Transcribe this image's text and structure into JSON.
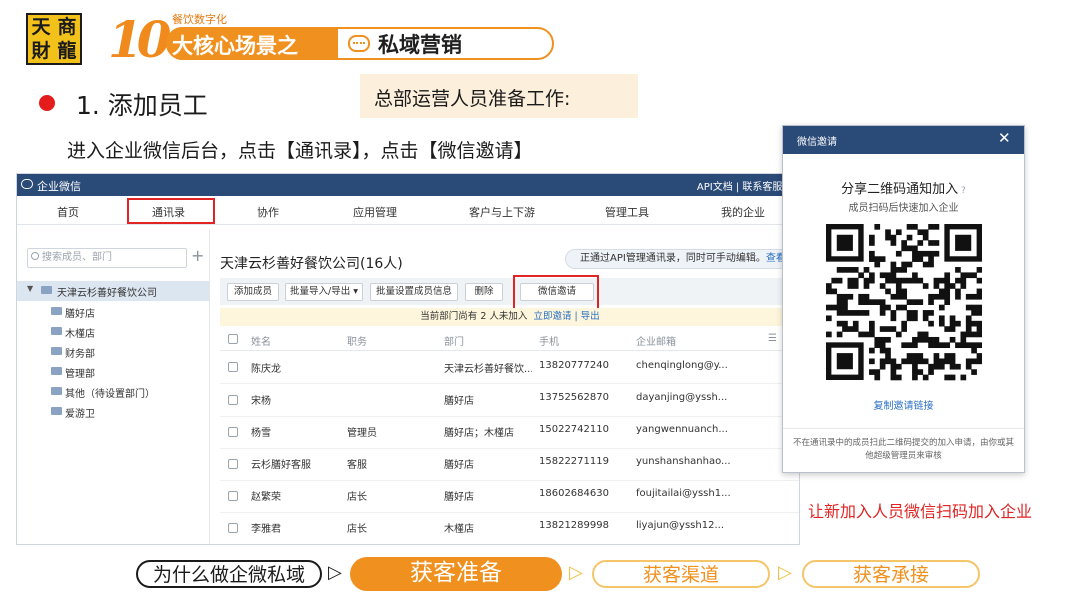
{
  "logo": {
    "chars": [
      "天",
      "商",
      "財",
      "龍"
    ]
  },
  "header": {
    "big_number": "10",
    "small_tag": "餐饮数字化",
    "banner_left": "大核心场景之",
    "banner_right": "私域营销",
    "chat_icon": "chat-bubble-icon"
  },
  "section": {
    "title": "1. 添加员工",
    "prep_label": "总部运营人员准备工作:",
    "instruction": "进入企业微信后台，点击【通讯录】，点击【微信邀请】"
  },
  "wework": {
    "app_name": "企业微信",
    "top_links": "API文档  |  联系客服  |",
    "nav": [
      "首页",
      "通讯录",
      "协作",
      "应用管理",
      "客户与上下游",
      "管理工具",
      "我的企业"
    ],
    "search_placeholder": "搜索成员、部门",
    "tree_root": "天津云杉善好餐饮公司",
    "tree_children": [
      "膳好店",
      "木槿店",
      "财务部",
      "管理部",
      "其他（待设置部门）",
      "爱游卫"
    ],
    "company_title": "天津云杉善好餐饮公司(16人)",
    "api_notice": "正通过API管理通讯录，同时可手动编辑。",
    "api_link": "查看",
    "toolbar": [
      "添加成员",
      "批量导入/导出 ▾",
      "批量设置成员信息",
      "删除",
      "微信邀请"
    ],
    "notice_text": "当前部门尚有 2 人未加入",
    "notice_links": "立即邀请 | 导出",
    "columns": [
      "姓名",
      "职务",
      "部门",
      "手机",
      "企业邮箱"
    ],
    "rows": [
      {
        "name": "陈庆龙",
        "role": "",
        "dept": "天津云杉善好餐饮...",
        "phone": "13820777240",
        "email": "chenqinglong@y..."
      },
      {
        "name": "宋杨",
        "role": "",
        "dept": "膳好店",
        "phone": "13752562870",
        "email": "dayanjing@yssh..."
      },
      {
        "name": "杨雪",
        "role": "管理员",
        "dept": "膳好店；木槿店",
        "phone": "15022742110",
        "email": "yangwennuanch..."
      },
      {
        "name": "云杉膳好客服",
        "role": "客服",
        "dept": "膳好店",
        "phone": "15822271119",
        "email": "yunshanshanhao..."
      },
      {
        "name": "赵繁荣",
        "role": "店长",
        "dept": "膳好店",
        "phone": "18602684630",
        "email": "foujitailai@yssh1..."
      },
      {
        "name": "李雅君",
        "role": "店长",
        "dept": "木槿店",
        "phone": "13821289998",
        "email": "liyajun@yssh12..."
      }
    ]
  },
  "popup": {
    "title": "微信邀请",
    "heading": "分享二维码通知加入",
    "subtitle": "成员扫码后快速加入企业",
    "copy_link": "复制邀请链接",
    "footer": "不在通讯录中的成员扫此二维码提交的加入申请，由你或其他超级管理员来审核"
  },
  "red_note": "让新加入人员微信扫码加入企业",
  "bottom_nav": [
    "为什么做企微私域",
    "获客准备",
    "获客渠道",
    "获客承接"
  ],
  "colors": {
    "orange": "#f0901e",
    "red": "#e02424",
    "navy": "#2a4a78",
    "link": "#2a6fc4"
  }
}
